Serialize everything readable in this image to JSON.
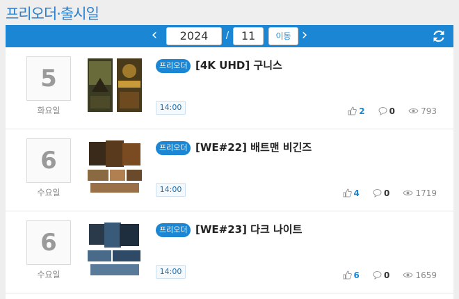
{
  "page": {
    "title": "프리오더·출시일"
  },
  "nav": {
    "year": "2024",
    "separator": "/",
    "month": "11",
    "go_label": "이동",
    "prev_icon": "chevron-left-icon",
    "next_icon": "chevron-right-icon",
    "refresh_icon": "refresh-icon",
    "accent_color": "#1a86d4"
  },
  "items": [
    {
      "day": "5",
      "weekday": "화요일",
      "badge": "프리오더",
      "title": "[4K UHD] 구니스",
      "time": "14:00",
      "likes": "2",
      "comments": "0",
      "views": "793"
    },
    {
      "day": "6",
      "weekday": "수요일",
      "badge": "프리오더",
      "title": "[WE#22] 배트맨 비긴즈",
      "time": "14:00",
      "likes": "4",
      "comments": "0",
      "views": "1719"
    },
    {
      "day": "6",
      "weekday": "수요일",
      "badge": "프리오더",
      "title": "[WE#23] 다크 나이트",
      "time": "14:00",
      "likes": "6",
      "comments": "0",
      "views": "1659"
    }
  ]
}
